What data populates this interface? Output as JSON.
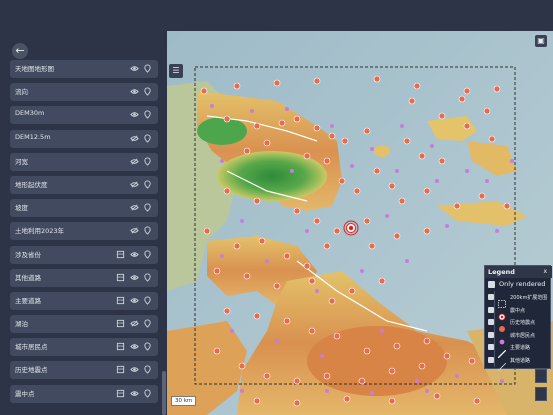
{
  "sidebar": {
    "back_icon": "arrow-left-icon",
    "layers": [
      {
        "label": "天地图地形图",
        "visible": true,
        "has_table": false
      },
      {
        "label": "流向",
        "visible": true,
        "has_table": false
      },
      {
        "label": "DEM30m",
        "visible": true,
        "has_table": false
      },
      {
        "label": "DEM12.5m",
        "visible": false,
        "has_table": false
      },
      {
        "label": "河宽",
        "visible": false,
        "has_table": false
      },
      {
        "label": "地形起伏度",
        "visible": false,
        "has_table": false
      },
      {
        "label": "坡度",
        "visible": false,
        "has_table": false
      },
      {
        "label": "土地利用2023年",
        "visible": false,
        "has_table": false
      },
      {
        "label": "涉及省份",
        "visible": true,
        "has_table": true
      },
      {
        "label": "其他道路",
        "visible": true,
        "has_table": true
      },
      {
        "label": "主要道路",
        "visible": true,
        "has_table": true
      },
      {
        "label": "湖泊",
        "visible": false,
        "has_table": true
      },
      {
        "label": "城市居民点",
        "visible": true,
        "has_table": true
      },
      {
        "label": "历史地震点",
        "visible": true,
        "has_table": true
      },
      {
        "label": "震中点",
        "visible": true,
        "has_table": true
      }
    ]
  },
  "map": {
    "scale_label": "30 km",
    "colors": {
      "sea": "#a9c4cf",
      "lowland_green": "#3f9e4a",
      "midland_yellow": "#e6c15f",
      "highland_orange": "#d98a4a",
      "quake_marker": "#e96b4e",
      "city_marker": "#c77ddb",
      "epicenter": "#e02020"
    }
  },
  "legend": {
    "title": "Legend",
    "close": "x",
    "only_rendered_label": "Only rendered",
    "items": [
      {
        "label": "200km扩展范围",
        "swatch": "dashed-rect"
      },
      {
        "label": "震中点",
        "swatch": "epicenter"
      },
      {
        "label": "历史地震点",
        "swatch": "quake"
      },
      {
        "label": "城市居民点",
        "swatch": "city"
      },
      {
        "label": "主要道路",
        "swatch": "major-road"
      },
      {
        "label": "其他道路",
        "swatch": "minor-road"
      }
    ]
  }
}
